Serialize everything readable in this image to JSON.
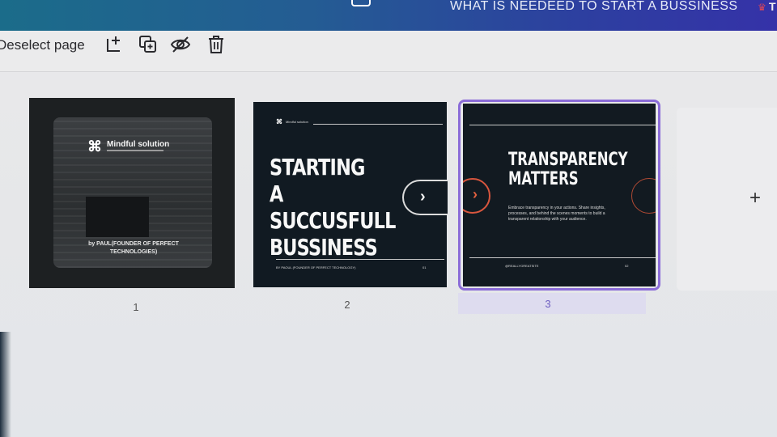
{
  "topbar": {
    "doc_title": "WHAT IS NEEDEED TO START A BUSSINESS",
    "right_letter": "T"
  },
  "toolbar": {
    "deselect_label": "Deselect page",
    "icons": [
      "add-page-icon",
      "duplicate-page-icon",
      "hide-page-icon",
      "delete-page-icon"
    ]
  },
  "pages": [
    {
      "number": "1",
      "brand": "Mindful solution",
      "byline": "by PAUL(FOUNDER OF PERFECT TECHNOLOGIES)"
    },
    {
      "number": "2",
      "brand": "Mindful solution",
      "headline": "STARTING A SUCCUSFULL BUSSINESS",
      "footer_by": "BY PAOUL (FOUNDER OF PERFECT TECHNOLOGY)",
      "footer_num": "01"
    },
    {
      "number": "3",
      "headline": "TRANSPARENCY MATTERS",
      "body": "Embrace transparency in your actions. Share insights, processes, and behind the scenes moments to build a transparent relationship with your audience.",
      "footer_handle": "@REALLYGREATSITE",
      "footer_num": "02"
    }
  ],
  "add_page_symbol": "+",
  "colors": {
    "selection": "#8b6cd8",
    "accent_arrow": "#d8563e",
    "slide_bg": "#121a21"
  }
}
